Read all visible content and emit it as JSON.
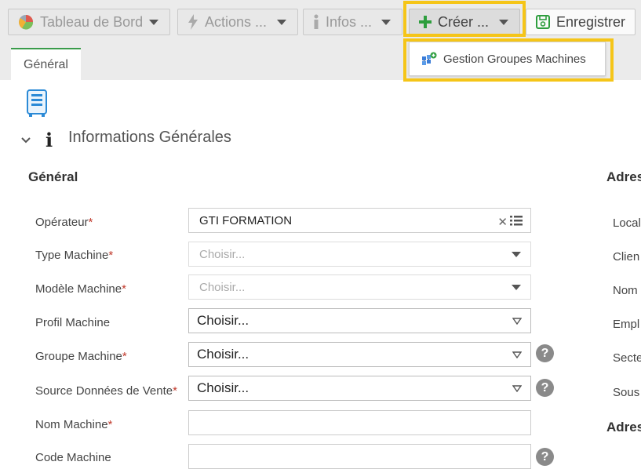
{
  "toolbar": {
    "tableau_label": "Tableau de Bord",
    "actions_label": "Actions ...",
    "infos_label": "Infos ...",
    "creer_label": "Créer ...",
    "enregistrer_label": "Enregistrer"
  },
  "dropdown": {
    "item_label": "Gestion Groupes Machines"
  },
  "tabs": [
    {
      "label": "Général",
      "active": true
    }
  ],
  "section": {
    "title": "Informations Générales"
  },
  "groups": {
    "general": "Général",
    "adresse1": "Adres",
    "adresse2": "Adres"
  },
  "fields": {
    "operateur": {
      "label": "Opérateur",
      "value": "GTI FORMATION"
    },
    "type_machine": {
      "label": "Type Machine",
      "placeholder": "Choisir..."
    },
    "modele_machine": {
      "label": "Modèle Machine",
      "placeholder": "Choisir..."
    },
    "profil_machine": {
      "label": "Profil Machine",
      "value": "Choisir..."
    },
    "groupe_machine": {
      "label": "Groupe Machine",
      "value": "Choisir..."
    },
    "source_donnees": {
      "label": "Source Données de Vente",
      "value": "Choisir..."
    },
    "nom_machine": {
      "label": "Nom Machine",
      "value": ""
    },
    "code_machine": {
      "label": "Code Machine",
      "value": ""
    }
  },
  "required_marker": "*",
  "help_glyph": "?",
  "clear_glyph": "✕",
  "right_labels": [
    "Local",
    "Clien",
    "Nom",
    "Empl",
    "Secte",
    "Sous"
  ],
  "colors": {
    "highlight": "#f5c518",
    "tab_accent": "#3a9b4a",
    "plus_green": "#2e9e3e",
    "required": "#c0392b"
  }
}
